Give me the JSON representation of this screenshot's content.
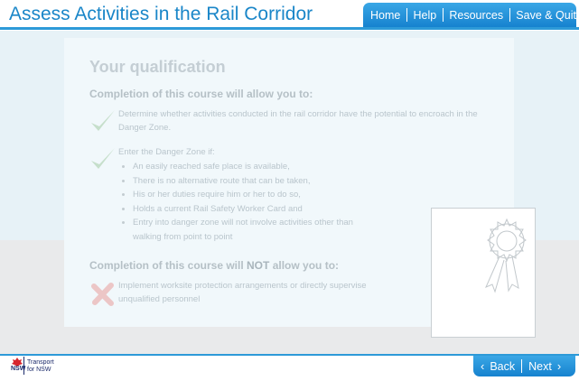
{
  "header": {
    "course_title": "Assess Activities in the Rail Corridor",
    "nav": {
      "home": "Home",
      "help": "Help",
      "resources": "Resources",
      "save_quit": "Save & Quit"
    }
  },
  "content": {
    "heading": "Your qualification",
    "allow_heading": "Completion of this course will allow you  to:",
    "allow_item_1": "Determine whether activities conducted in the rail corridor have the potential to encroach in the Danger Zone.",
    "allow_item_2_intro": "Enter the Danger Zone if:",
    "conditions": [
      "An easily reached safe place is available,",
      "There is no alternative route that can be taken,",
      "His or her duties require him or her to do so,",
      "Holds a current Rail Safety Worker Card and",
      "Entry into danger zone will not involve activities other than walking from point to point"
    ],
    "not_allow_heading_prefix": "Completion of this course will ",
    "not_allow_heading_emphasis": "NOT",
    "not_allow_heading_suffix": " allow you to:",
    "not_allow_item_1": "Implement worksite protection arrangements or directly supervise unqualified personnel"
  },
  "footer": {
    "logo_text_line1": "Transport",
    "logo_text_line2": "for NSW",
    "logo_nsw": "NSW",
    "back_label": "Back",
    "next_label": "Next"
  },
  "colors": {
    "brand_blue": "#1a86c8",
    "nav_blue": "#2d9ad8"
  },
  "icons": {
    "check": "check-icon",
    "cross": "cross-icon",
    "certificate": "certificate-rosette-icon"
  }
}
